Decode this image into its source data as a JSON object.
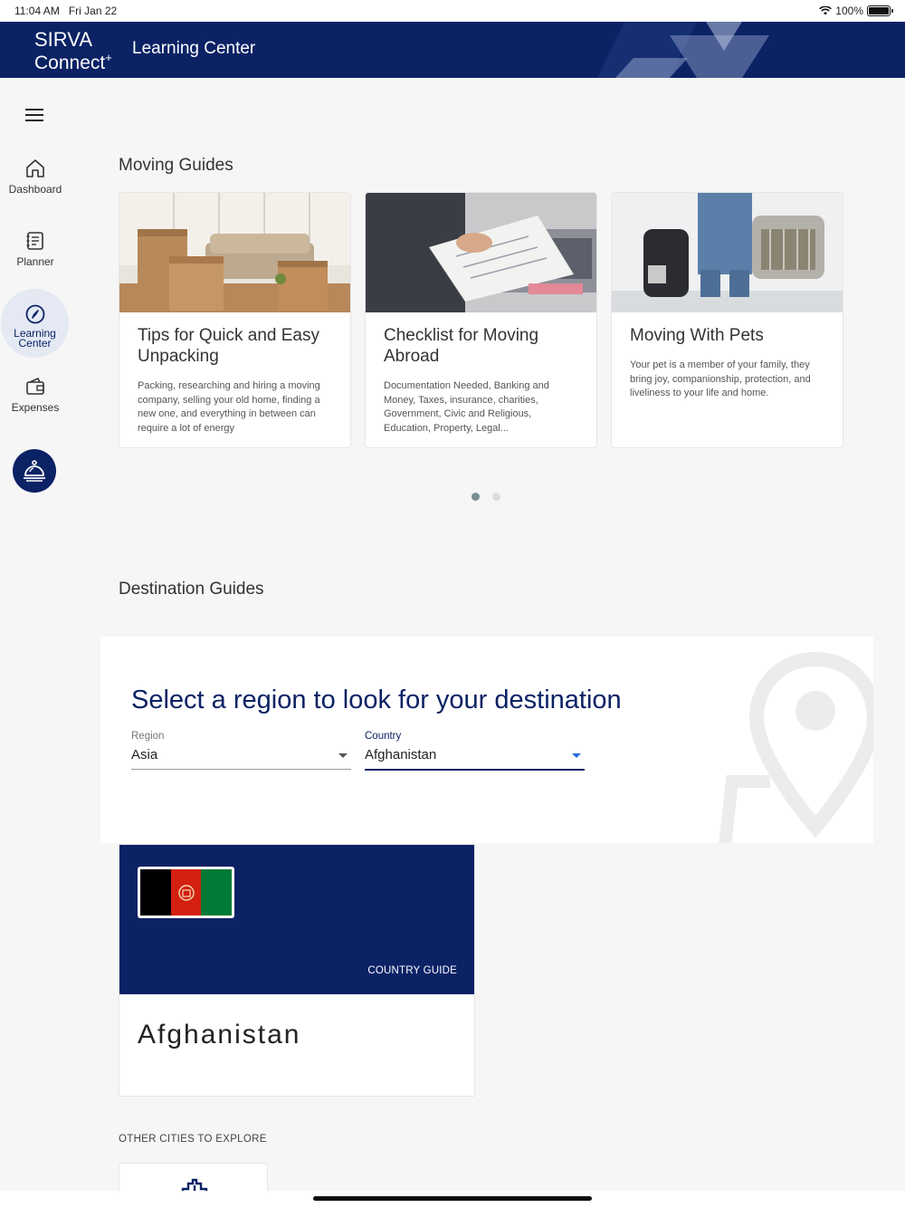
{
  "status": {
    "time": "11:04 AM",
    "date": "Fri Jan 22",
    "battery": "100%"
  },
  "header": {
    "logo_line1": "SIRVA",
    "logo_line2": "Connect",
    "logo_plus": "+",
    "title": "Learning Center"
  },
  "sidebar": {
    "items": [
      {
        "label": "Dashboard",
        "icon": "home-icon"
      },
      {
        "label": "Planner",
        "icon": "planner-icon"
      },
      {
        "label_line1": "Learning",
        "label_line2": "Center",
        "icon": "compass-icon",
        "active": true
      },
      {
        "label": "Expenses",
        "icon": "wallet-icon"
      }
    ],
    "fab_icon": "concierge-bell-icon"
  },
  "moving_guides": {
    "title": "Moving Guides",
    "cards": [
      {
        "title": "Tips for Quick and Easy Unpacking",
        "desc": "Packing, researching and hiring a moving company, selling your old home, finding a new one, and everything in between can require a lot of energy"
      },
      {
        "title": "Checklist for Moving Abroad",
        "desc": "Documentation Needed, Banking and Money, Taxes, insurance, charities, Government, Civic and Religious, Education, Property, Legal..."
      },
      {
        "title": "Moving With Pets",
        "desc": "Your pet is a member of your family, they bring joy, companionship, protection, and liveliness to your life and home."
      }
    ],
    "pages": 2,
    "current_page": 1
  },
  "destination_guides": {
    "title": "Destination Guides",
    "prompt": "Select a region to look for your destination",
    "region": {
      "label": "Region",
      "value": "Asia"
    },
    "country": {
      "label": "Country",
      "value": "Afghanistan"
    },
    "country_card": {
      "label": "COUNTRY GUIDE",
      "name": "Afghanistan",
      "flag_colors": [
        "#000000",
        "#d32011",
        "#007a36"
      ]
    },
    "other_cities_title": "OTHER CITIES TO EXPLORE"
  },
  "colors": {
    "brand": "#0b2265",
    "accent": "#2b6ad8"
  }
}
